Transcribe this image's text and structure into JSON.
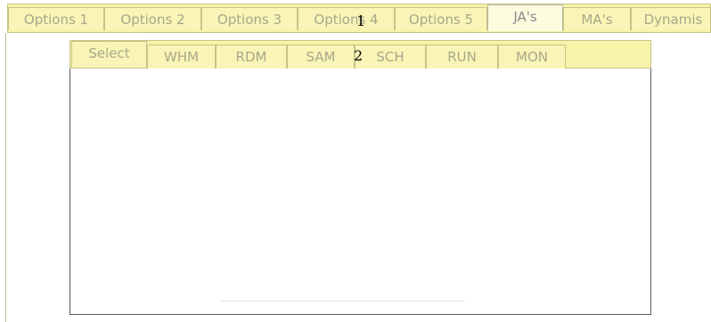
{
  "top_tabs": [
    {
      "label": "Options 1",
      "active": false
    },
    {
      "label": "Options 2",
      "active": false
    },
    {
      "label": "Options 3",
      "active": false
    },
    {
      "label": "Options 4",
      "active": false
    },
    {
      "label": "Options 5",
      "active": false
    },
    {
      "label": "JA's",
      "active": true
    },
    {
      "label": "MA's",
      "active": false
    },
    {
      "label": "Dynamis",
      "active": false
    }
  ],
  "sub_tabs": [
    {
      "label": "Select",
      "active": true
    },
    {
      "label": "WHM",
      "active": false
    },
    {
      "label": "RDM",
      "active": false
    },
    {
      "label": "SAM",
      "active": false
    },
    {
      "label": "SCH",
      "active": false
    },
    {
      "label": "RUN",
      "active": false
    },
    {
      "label": "MON",
      "active": false
    }
  ],
  "markers": {
    "one": "1",
    "two": "2"
  },
  "colors": {
    "tab_bg": "#f9f5b6",
    "bar_bg": "#f7f3a8",
    "tab_text": "#a9a78c",
    "active_tab_bg": "#fdfbe0"
  }
}
